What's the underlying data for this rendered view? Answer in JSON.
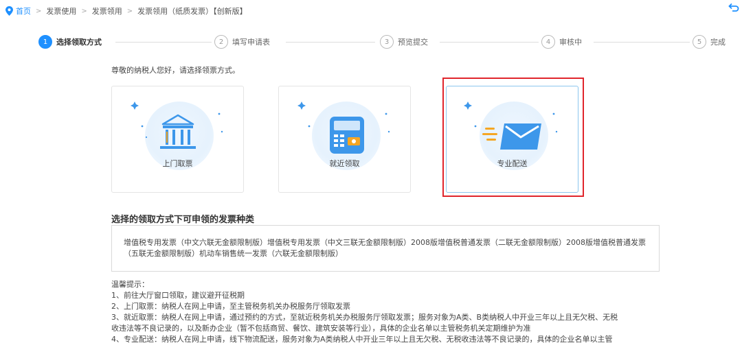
{
  "breadcrumb": {
    "home": "首页",
    "items": [
      "发票使用",
      "发票领用",
      "发票领用（纸质发票）【创新版】"
    ]
  },
  "steps": [
    {
      "num": "1",
      "label": "选择领取方式"
    },
    {
      "num": "2",
      "label": "填写申请表"
    },
    {
      "num": "3",
      "label": "预览提交"
    },
    {
      "num": "4",
      "label": "审核中"
    },
    {
      "num": "5",
      "label": "完成"
    }
  ],
  "intro": "尊敬的纳税人您好，请选择领票方式。",
  "methods": [
    {
      "label": "上门取票",
      "icon": "bank-building-icon"
    },
    {
      "label": "就近领取",
      "icon": "invoice-terminal-icon"
    },
    {
      "label": "专业配送",
      "icon": "express-mail-icon",
      "selected": true
    }
  ],
  "section_title": "选择的领取方式下可申领的发票种类",
  "invoice_types": "增值税专用发票（中文六联无金额限制版）增值税专用发票（中文三联无金额限制版）2008版增值税普通发票（二联无金额限制版）2008版增值税普通发票（五联无金额限制版）机动车销售统一发票（六联无金额限制版）",
  "tips": {
    "title": "温馨提示：",
    "lines": [
      "1、前往大厅窗口领取，建议避开征税期",
      "2、上门取票：纳税人在网上申请，至主管税务机关办税服务厅领取发票",
      "3、就近取票：纳税人在网上申请，通过预约的方式，至就近税务机关办税服务厅领取发票；服务对象为A类、B类纳税人中开业三年以上且无欠税、无税",
      "收违法等不良记录的，以及新办企业（暂不包括商贸、餐饮、建筑安装等行业），具体的企业名单以主管税务机关定期维护为准",
      "4、专业配送：纳税人在网上申请，线下物流配送，服务对象为A类纳税人中开业三年以上且无欠税、无税收违法等不良记录的，具体的企业名单以主管"
    ]
  },
  "colors": {
    "accent": "#1e90ff",
    "highlight": "#e0242b",
    "icon_blue": "#3d97ea",
    "icon_orange": "#f5a623"
  }
}
